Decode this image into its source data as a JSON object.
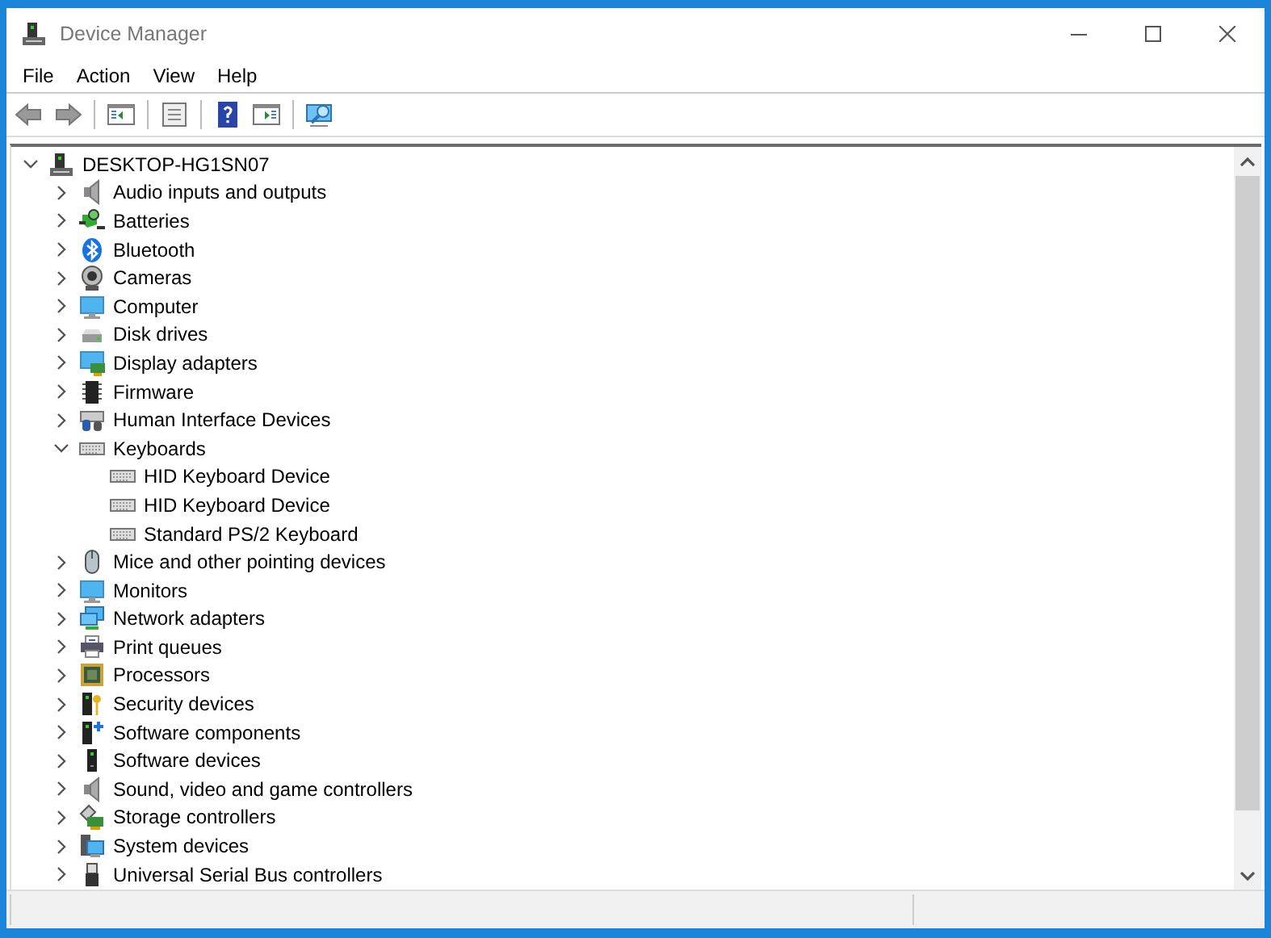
{
  "window": {
    "title": "Device Manager"
  },
  "menu": [
    "File",
    "Action",
    "View",
    "Help"
  ],
  "tree": {
    "label": "DESKTOP-HG1SN07",
    "kind": "tower",
    "expanded": true,
    "children": [
      {
        "label": "Audio inputs and outputs",
        "kind": "speaker",
        "expanded": false
      },
      {
        "label": "Batteries",
        "kind": "battery",
        "expanded": false
      },
      {
        "label": "Bluetooth",
        "kind": "bluetooth",
        "expanded": false
      },
      {
        "label": "Cameras",
        "kind": "camera",
        "expanded": false
      },
      {
        "label": "Computer",
        "kind": "monitor",
        "expanded": false
      },
      {
        "label": "Disk drives",
        "kind": "disk",
        "expanded": false
      },
      {
        "label": "Display adapters",
        "kind": "adapter",
        "expanded": false
      },
      {
        "label": "Firmware",
        "kind": "chip",
        "expanded": false
      },
      {
        "label": "Human Interface Devices",
        "kind": "hid",
        "expanded": false
      },
      {
        "label": "Keyboards",
        "kind": "keyboard",
        "expanded": true,
        "children": [
          {
            "label": "HID Keyboard Device",
            "kind": "keyboard"
          },
          {
            "label": "HID Keyboard Device",
            "kind": "keyboard"
          },
          {
            "label": "Standard PS/2 Keyboard",
            "kind": "keyboard"
          }
        ]
      },
      {
        "label": "Mice and other pointing devices",
        "kind": "mouse",
        "expanded": false
      },
      {
        "label": "Monitors",
        "kind": "monitor",
        "expanded": false
      },
      {
        "label": "Network adapters",
        "kind": "network",
        "expanded": false
      },
      {
        "label": "Print queues",
        "kind": "printer",
        "expanded": false
      },
      {
        "label": "Processors",
        "kind": "processor",
        "expanded": false
      },
      {
        "label": "Security devices",
        "kind": "security",
        "expanded": false
      },
      {
        "label": "Software components",
        "kind": "component",
        "expanded": false
      },
      {
        "label": "Software devices",
        "kind": "softdev",
        "expanded": false
      },
      {
        "label": "Sound, video and game controllers",
        "kind": "speaker",
        "expanded": false
      },
      {
        "label": "Storage controllers",
        "kind": "storage",
        "expanded": false
      },
      {
        "label": "System devices",
        "kind": "system",
        "expanded": false
      },
      {
        "label": "Universal Serial Bus controllers",
        "kind": "usb",
        "expanded": false
      }
    ]
  }
}
